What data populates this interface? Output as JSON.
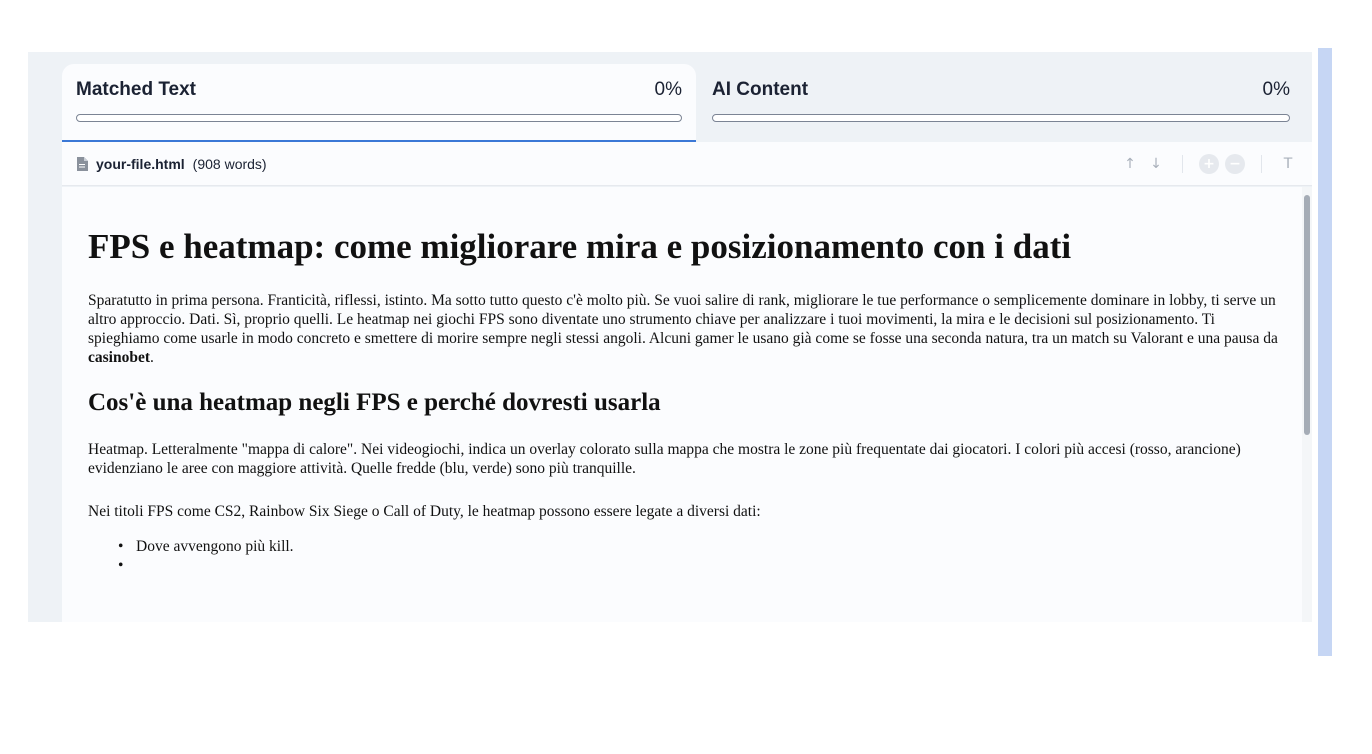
{
  "tabs": [
    {
      "label": "Matched Text",
      "percent": "0%"
    },
    {
      "label": "AI Content",
      "percent": "0%"
    }
  ],
  "file": {
    "name": "your-file.html",
    "words": "(908 words)"
  },
  "tools": {
    "up": "↑",
    "down": "↓",
    "zoom_in": "+",
    "zoom_out": "−",
    "text": "T"
  },
  "document": {
    "h1": "FPS e heatmap: come migliorare mira e posizionamento con i dati",
    "intro_p1": "Sparatutto in prima persona. Franticità, riflessi, istinto. Ma sotto tutto questo c'è molto più. Se vuoi salire di rank, migliorare le tue performance o semplicemente dominare in lobby, ti serve un altro approccio. Dati. Sì, proprio quelli. Le heatmap nei giochi FPS sono diventate uno strumento chiave per analizzare i tuoi movimenti, la mira e le decisioni sul posizionamento. Ti spieghiamo come usarle in modo concreto e smettere di morire sempre negli stessi angoli. Alcuni gamer le usano già come se fosse una seconda natura, tra un match su Valorant e una pausa da ",
    "intro_bold": "casinobet",
    "intro_end": ".",
    "h2": "Cos'è una heatmap negli FPS e perché dovresti usarla",
    "p2": "Heatmap. Letteralmente \"mappa di calore\". Nei videogiochi, indica un overlay colorato sulla mappa che mostra le zone più frequentate dai giocatori. I colori più accesi (rosso, arancione) evidenziano le aree con maggiore attività. Quelle fredde (blu, verde) sono più tranquille.",
    "p3": "Nei titoli FPS come CS2, Rainbow Six Siege o Call of Duty, le heatmap possono essere legate a diversi dati:",
    "list": [
      "Dove avvengono più kill.",
      ""
    ]
  }
}
